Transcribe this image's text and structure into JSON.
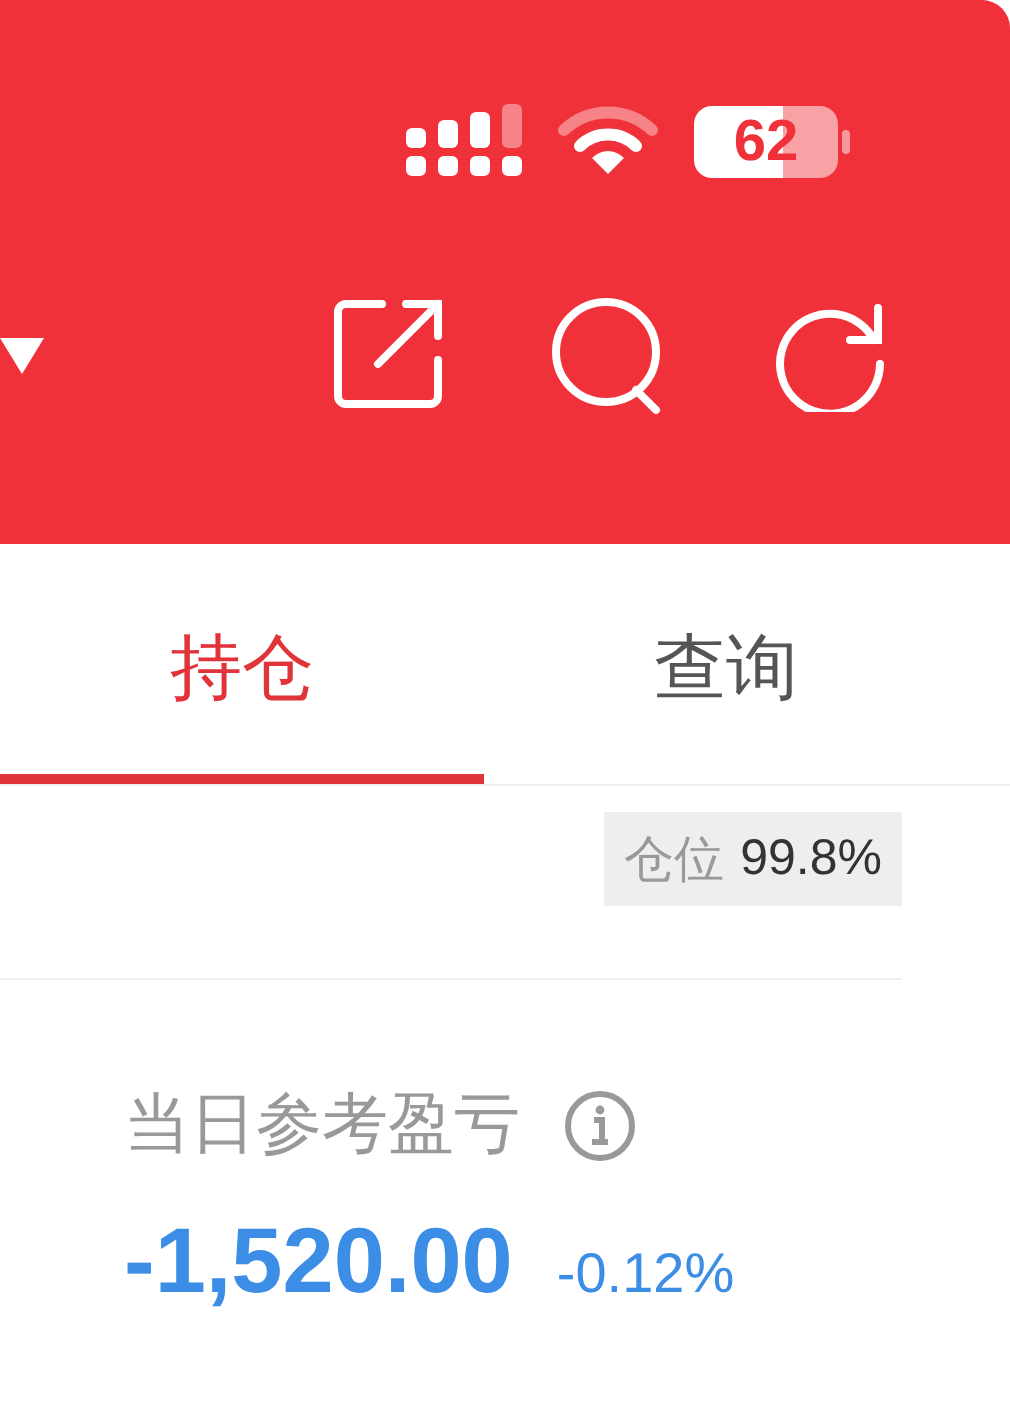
{
  "status_bar": {
    "battery": "62"
  },
  "tabs": [
    {
      "label": "持仓",
      "selected": true
    },
    {
      "label": "查询",
      "selected": false
    }
  ],
  "position": {
    "label": "仓位",
    "value": "99.8%"
  },
  "pnl": {
    "label": "当日参考盈亏",
    "amount": "-1,520.00",
    "percent": "-0.12%"
  }
}
